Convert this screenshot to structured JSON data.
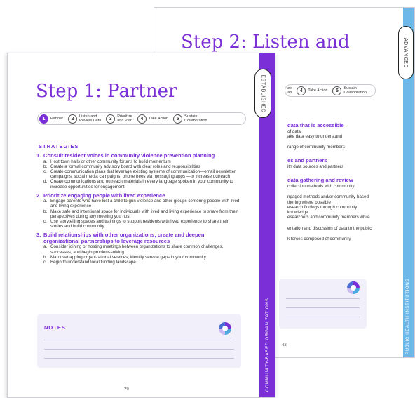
{
  "back_page": {
    "title": "Step 2: Listen and",
    "tab": "ADVANCED",
    "side_label": "PUBLIC HEALTH INSTITUTIONS",
    "stepper": [
      {
        "num": "",
        "label": "ize\nlan"
      },
      {
        "num": "4",
        "label": "Take Action"
      },
      {
        "num": "5",
        "label": "Sustain\nCollaboration"
      }
    ],
    "content": [
      {
        "type": "heading",
        "text": "data that is accessible"
      },
      {
        "type": "text",
        "text": "of data"
      },
      {
        "type": "text",
        "text": "ake data easy to understand"
      },
      {
        "type": "gap"
      },
      {
        "type": "text",
        "text": "range of community members"
      },
      {
        "type": "gap"
      },
      {
        "type": "heading",
        "text": "es and partners"
      },
      {
        "type": "text",
        "text": "ith data sources and partners"
      },
      {
        "type": "gap"
      },
      {
        "type": "heading",
        "text": "data gathering and review"
      },
      {
        "type": "text",
        "text": "collection methods with community"
      },
      {
        "type": "gap"
      },
      {
        "type": "text",
        "text": "ngaged methods and/or community-based"
      },
      {
        "type": "text",
        "text": "thering where possible"
      },
      {
        "type": "text",
        "text": "esearch findings through community"
      },
      {
        "type": "text",
        "text": "knowledge"
      },
      {
        "type": "text",
        "text": "esearchers and community members while"
      },
      {
        "type": "gap"
      },
      {
        "type": "text",
        "text": "entation and discussion of data to the public"
      },
      {
        "type": "gap"
      },
      {
        "type": "text",
        "text": "k forces composed of community"
      }
    ],
    "page_number": "42"
  },
  "front_page": {
    "title": "Step 1: Partner",
    "tab": "ESTABLISHED",
    "side_label": "COMMUNITY-BASED ORGANIZATIONS",
    "stepper": [
      {
        "num": "1",
        "label": "Partner",
        "active": true
      },
      {
        "num": "2",
        "label": "Listen and\nReview Data"
      },
      {
        "num": "3",
        "label": "Prioritize\nand Plan"
      },
      {
        "num": "4",
        "label": "Take Action"
      },
      {
        "num": "5",
        "label": "Sustain\nCollaboration"
      }
    ],
    "strategies_heading": "STRATEGIES",
    "strategies": [
      {
        "num": "1.",
        "title": "Consult resident voices in community violence prevention planning",
        "items": [
          {
            "l": "a.",
            "t": "Host town halls or other community forums to build momentum"
          },
          {
            "l": "b.",
            "t": "Create a formal community advisory board with clear roles and responsibilities"
          },
          {
            "l": "c.",
            "t": "Create communication plans that leverage existing systems of communication—email newsletter campaigns, social media campaigns, phone trees via messaging apps —to increase outreach"
          },
          {
            "l": "d.",
            "t": "Create communications and outreach materials in every language spoken in your community to increase opportunities for engagement"
          }
        ]
      },
      {
        "num": "2.",
        "title": "Prioritize engaging people with lived experience",
        "items": [
          {
            "l": "a.",
            "t": "Engage parents who have lost a child to gun violence and other groups centering people with lived and living experience"
          },
          {
            "l": "b.",
            "t": "Make safe and intentional space for individuals with lived and living experience to share from their perspectives during any meeting you host"
          },
          {
            "l": "c.",
            "t": "Use storytelling spaces and trainings to support residents with lived experience to share their stories and build community"
          }
        ]
      },
      {
        "num": "3.",
        "title": "Build relationships with other organizations; create and deepen organizational partnerships to leverage resources",
        "items": [
          {
            "l": "a.",
            "t": "Consider joining or hosting meetings between organizations to share common challenges, successes, and begin problem-solving"
          },
          {
            "l": "b.",
            "t": "Map overlapping organizational services; identify service gaps in your community"
          },
          {
            "l": "c.",
            "t": "Begin to understand local funding landscape"
          }
        ]
      }
    ],
    "notes_title": "NOTES",
    "page_number": "29"
  },
  "colors": {
    "purple": "#7b2fd6",
    "blue": "#6db8e8"
  }
}
